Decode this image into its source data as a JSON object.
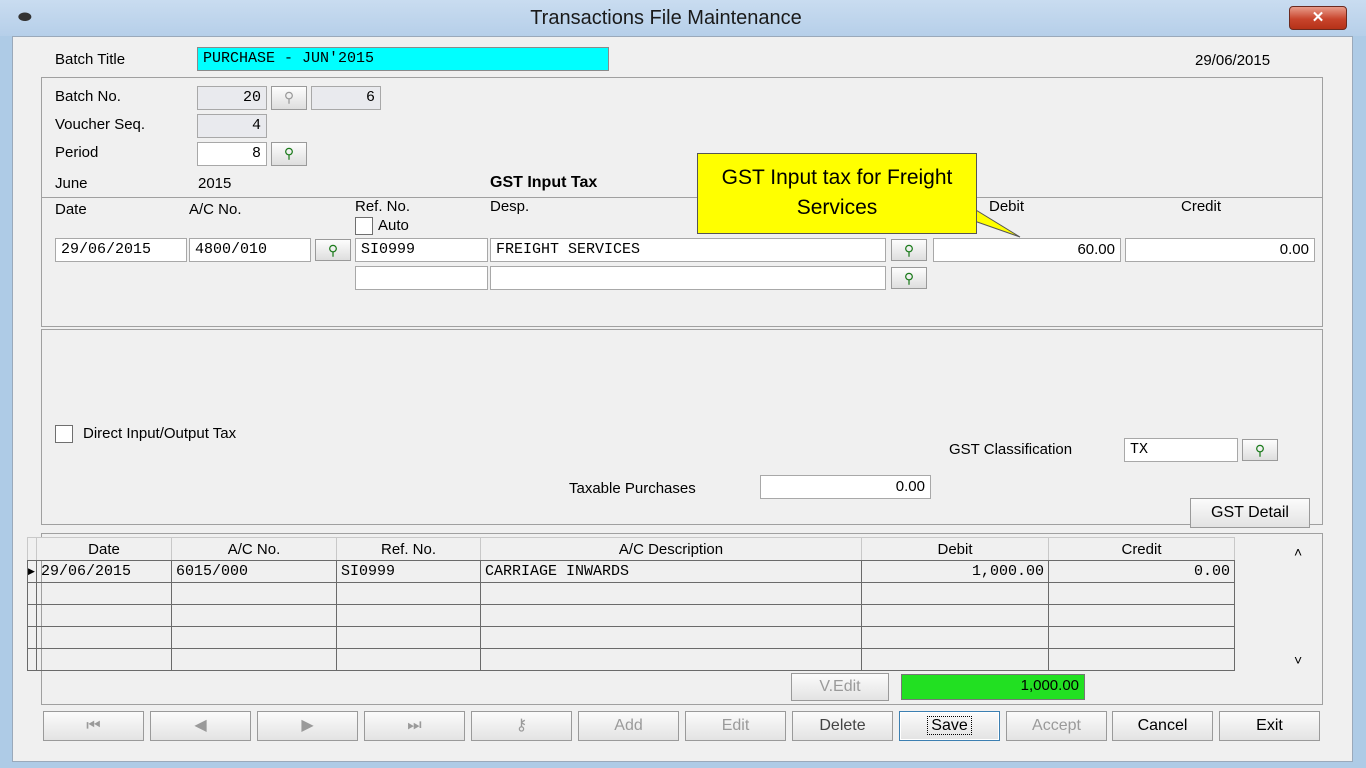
{
  "window": {
    "title": "Transactions File Maintenance",
    "close_label": "✕"
  },
  "header": {
    "batch_title_label": "Batch Title",
    "batch_title_value": "PURCHASE - JUN'2015",
    "date": "29/06/2015",
    "batch_no_label": "Batch No.",
    "batch_no_value": "20",
    "batch_no_count": "6",
    "voucher_seq_label": "Voucher Seq.",
    "voucher_seq_value": "4",
    "period_label": "Period",
    "period_value": "8",
    "period_month": "June",
    "period_year": "2015",
    "section_title": "GST Input Tax"
  },
  "entry": {
    "col_date": "Date",
    "col_ac_no": "A/C No.",
    "col_ref_no": "Ref. No.",
    "auto_label": "Auto",
    "col_desp": "Desp.",
    "col_debit": "Debit",
    "col_credit": "Credit",
    "date_value": "29/06/2015",
    "ac_no_value": "4800/010",
    "ref_no_value": "SI0999",
    "desp_value": "FREIGHT SERVICES",
    "debit_value": "60.00",
    "credit_value": "0.00",
    "ref_no_2": "",
    "desp_2": ""
  },
  "callout": {
    "text": "GST Input tax for Freight Services"
  },
  "tax": {
    "direct_label": "Direct Input/Output Tax",
    "gst_class_label": "GST Classification",
    "gst_class_value": "TX",
    "taxable_label": "Taxable Purchases",
    "taxable_value": "0.00",
    "gst_detail_label": "GST Detail"
  },
  "grid": {
    "headers": [
      "Date",
      "A/C No.",
      "Ref. No.",
      "A/C Description",
      "Debit",
      "Credit"
    ],
    "rows": [
      [
        "29/06/2015",
        "6015/000",
        "SI0999",
        "CARRIAGE INWARDS",
        "1,000.00",
        "0.00"
      ]
    ]
  },
  "footer": {
    "vedit_label": "V.Edit",
    "total_value": "1,000.00",
    "total_color": "#22e022"
  },
  "toolbar": {
    "first_icon": "first-record-icon",
    "prev_icon": "prev-record-icon",
    "next_icon": "next-record-icon",
    "last_icon": "last-record-icon",
    "find_icon": "find-key-icon",
    "add_label": "Add",
    "edit_label": "Edit",
    "delete_label": "Delete",
    "save_label": "Save",
    "accept_label": "Accept",
    "cancel_label": "Cancel",
    "exit_label": "Exit"
  }
}
